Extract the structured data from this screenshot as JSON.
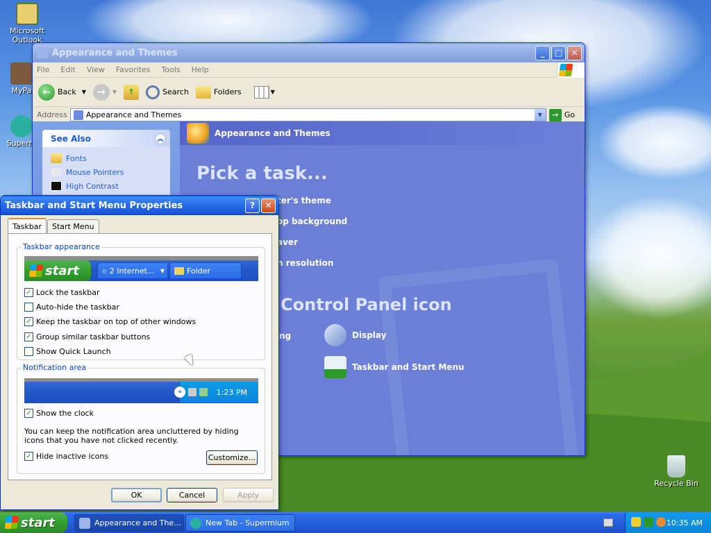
{
  "desktop": {
    "icons": [
      {
        "label": "Microsoft Outlook",
        "icon": "outlook-icon"
      },
      {
        "label": "MyPa",
        "icon": "mypa-icon"
      },
      {
        "label": "Superm",
        "icon": "supermium-icon"
      },
      {
        "label": "Recycle Bin",
        "icon": "recycle-bin-icon"
      }
    ]
  },
  "explorer": {
    "title": "Appearance and Themes",
    "menu": [
      "File",
      "Edit",
      "View",
      "Favorites",
      "Tools",
      "Help"
    ],
    "toolbar": {
      "back": "Back",
      "search": "Search",
      "folders": "Folders"
    },
    "address": {
      "label": "Address",
      "value": "Appearance and Themes",
      "go": "Go"
    },
    "see_also": {
      "title": "See Also",
      "links": [
        "Fonts",
        "Mouse Pointers",
        "High Contrast"
      ]
    },
    "content": {
      "header": "Appearance and Themes",
      "pick": "Pick a task...",
      "tasks": [
        "ter's theme",
        "op background",
        "aver",
        "n resolution"
      ],
      "cp_heading": "Control Panel icon",
      "cp_partial": "ng",
      "cp_items": [
        "Display",
        "Taskbar and Start Menu"
      ]
    }
  },
  "dialog": {
    "title": "Taskbar and Start Menu Properties",
    "tabs": [
      "Taskbar",
      "Start Menu"
    ],
    "appearance": {
      "legend": "Taskbar appearance",
      "preview": {
        "start": "start",
        "btn1": "2 Internet...",
        "btn2": "Folder"
      },
      "options": [
        {
          "label": "Lock the taskbar",
          "checked": true
        },
        {
          "label": "Auto-hide the taskbar",
          "checked": false
        },
        {
          "label": "Keep the taskbar on top of other windows",
          "checked": true
        },
        {
          "label": "Group similar taskbar buttons",
          "checked": true
        },
        {
          "label": "Show Quick Launch",
          "checked": false
        }
      ]
    },
    "notification": {
      "legend": "Notification area",
      "preview_time": "1:23 PM",
      "show_clock": "Show the clock",
      "note": "You can keep the notification area uncluttered by hiding icons that you have not clicked recently.",
      "hide_inactive": "Hide inactive icons",
      "customize": "Customize..."
    },
    "buttons": {
      "ok": "OK",
      "cancel": "Cancel",
      "apply": "Apply"
    }
  },
  "taskbar": {
    "start": "start",
    "buttons": [
      "Appearance and The...",
      "New Tab - Supermium"
    ],
    "clock": "10:35 AM"
  }
}
